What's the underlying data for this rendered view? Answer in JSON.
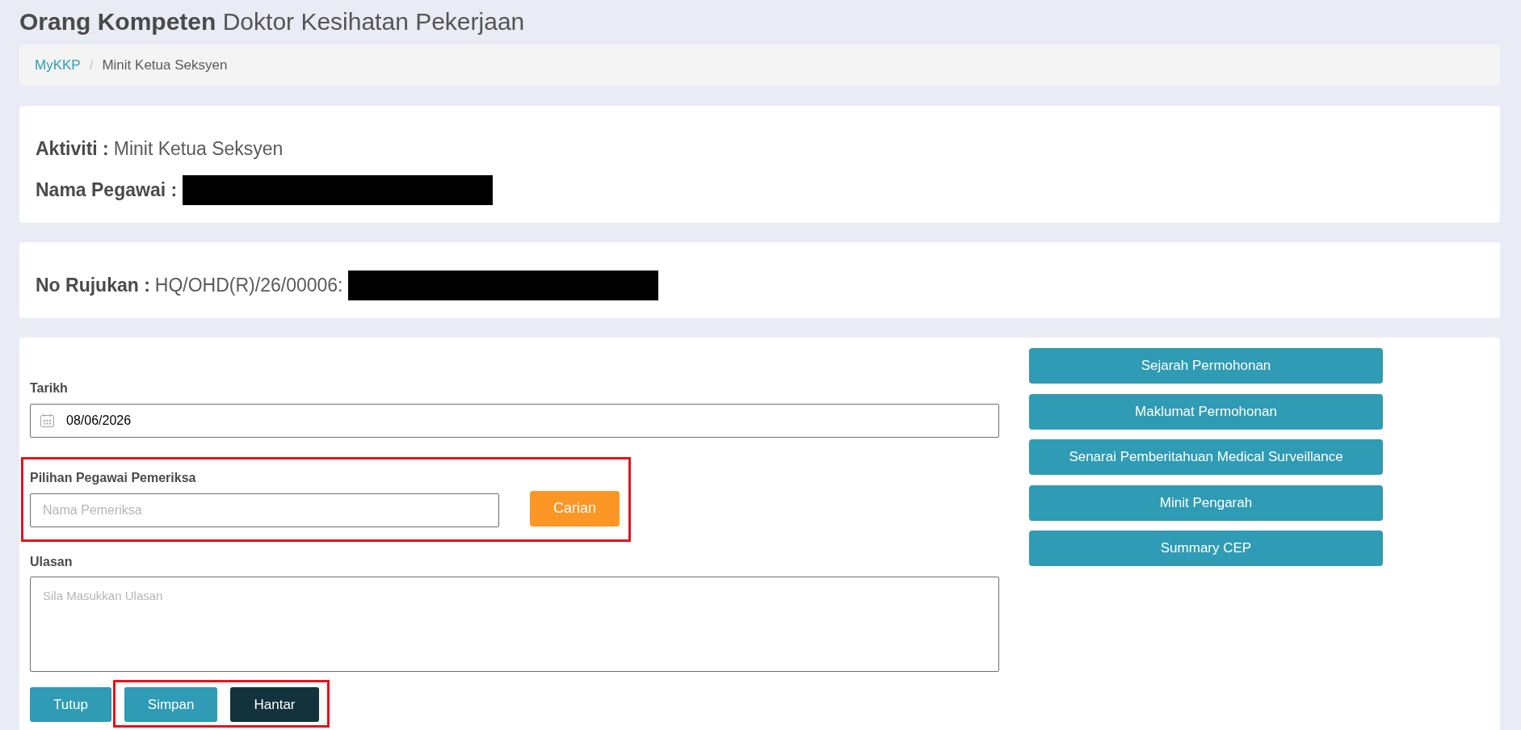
{
  "header": {
    "title": "**Orang Kompeten** Doktor Kesihatan Pekerjaan"
  },
  "breadcrumb": {
    "separator": "/",
    "items": [
      {
        "label": "MyKKP",
        "link": true
      },
      {
        "label": "Minit Ketua Seksyen",
        "link": false
      }
    ]
  },
  "info_cards": [
    {
      "fields": [
        {
          "label": "Aktiviti :",
          "value": "Minit Ketua Seksyen"
        },
        {
          "label": "Nama Pegawai :",
          "redacted": true
        }
      ]
    },
    {
      "fields": [
        {
          "label": "No Rujukan :",
          "value": "HQ/OHD(R)/26/00006:",
          "redacted": true
        }
      ]
    }
  ],
  "form": {
    "date": {
      "label": "Tarikh",
      "value": "08/06/2026"
    },
    "examiner": {
      "label": "Pilihan Pegawai Pemeriksa",
      "placeholder": "Nama Pemeriksa",
      "button": "Carian",
      "highlighted": true
    },
    "remarks": {
      "label": "Ulasan",
      "placeholder": "Sila Masukkan Ulasan"
    },
    "actions": [
      {
        "label": "Tutup",
        "kind": "default",
        "highlighted": false
      },
      {
        "label": "Simpan",
        "kind": "default",
        "highlighted": true
      },
      {
        "label": "Hantar",
        "kind": "submit",
        "highlighted": true
      }
    ]
  },
  "side_buttons": [
    "Sejarah Permohonan",
    "Maklumat Permohonan",
    "Senarai Pemberitahuan Medical Surveillance",
    "Minit Pengarah",
    "Summary CEP"
  ]
}
